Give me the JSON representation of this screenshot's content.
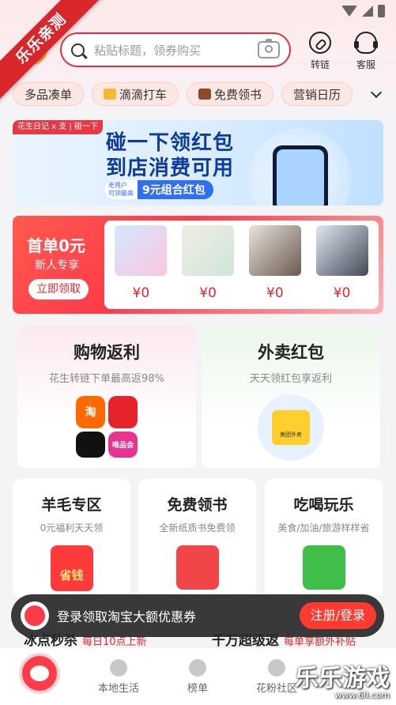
{
  "watermark_ribbon": "乐乐亲测",
  "search": {
    "placeholder": "粘贴标题，领券购买"
  },
  "top_actions": {
    "link": "转链",
    "service": "客服"
  },
  "chips": [
    "多品凑单",
    "滴滴打车",
    "免费领书",
    "营销日历"
  ],
  "banner": {
    "brand": "花生日记 x 支 | 碰一下",
    "line1": "碰一下领红包",
    "line2": "到店消费可用",
    "tag_line1": "老用户",
    "tag_line2": "可领最高",
    "amount": "9元组合红包"
  },
  "first_order": {
    "title": "首单0元",
    "subtitle": "新人专享",
    "button": "立即领取",
    "prices": [
      "¥0",
      "¥0",
      "¥0",
      "¥0"
    ]
  },
  "cards": {
    "rebate": {
      "title": "购物返利",
      "subtitle": "花生转链下单最高返98%",
      "apps": [
        "淘",
        "",
        "",
        "唯品会"
      ]
    },
    "takeout": {
      "title": "外卖红包",
      "subtitle": "天天领红包享返利",
      "box_label": "美团外卖"
    }
  },
  "small_cards": [
    {
      "title": "羊毛专区",
      "subtitle": "0元福利天天领",
      "icon_label": "省钱"
    },
    {
      "title": "免费领书",
      "subtitle": "全新纸质书免费领",
      "icon_label": ""
    },
    {
      "title": "吃喝玩乐",
      "subtitle": "美食/加油/旅游样样省",
      "icon_label": ""
    }
  ],
  "peek": [
    {
      "title": "冰点秒杀",
      "sub": "每日10点上新"
    },
    {
      "title": "千万超级返",
      "sub": "每单享额外补贴"
    }
  ],
  "login_bar": {
    "text": "登录领取淘宝大额优惠券",
    "button": "注册/登录"
  },
  "bottom_nav": [
    "本地生活",
    "榜单",
    "花粉社区"
  ],
  "site_watermark": {
    "title": "乐乐游戏",
    "url": "www.6ll.com"
  }
}
